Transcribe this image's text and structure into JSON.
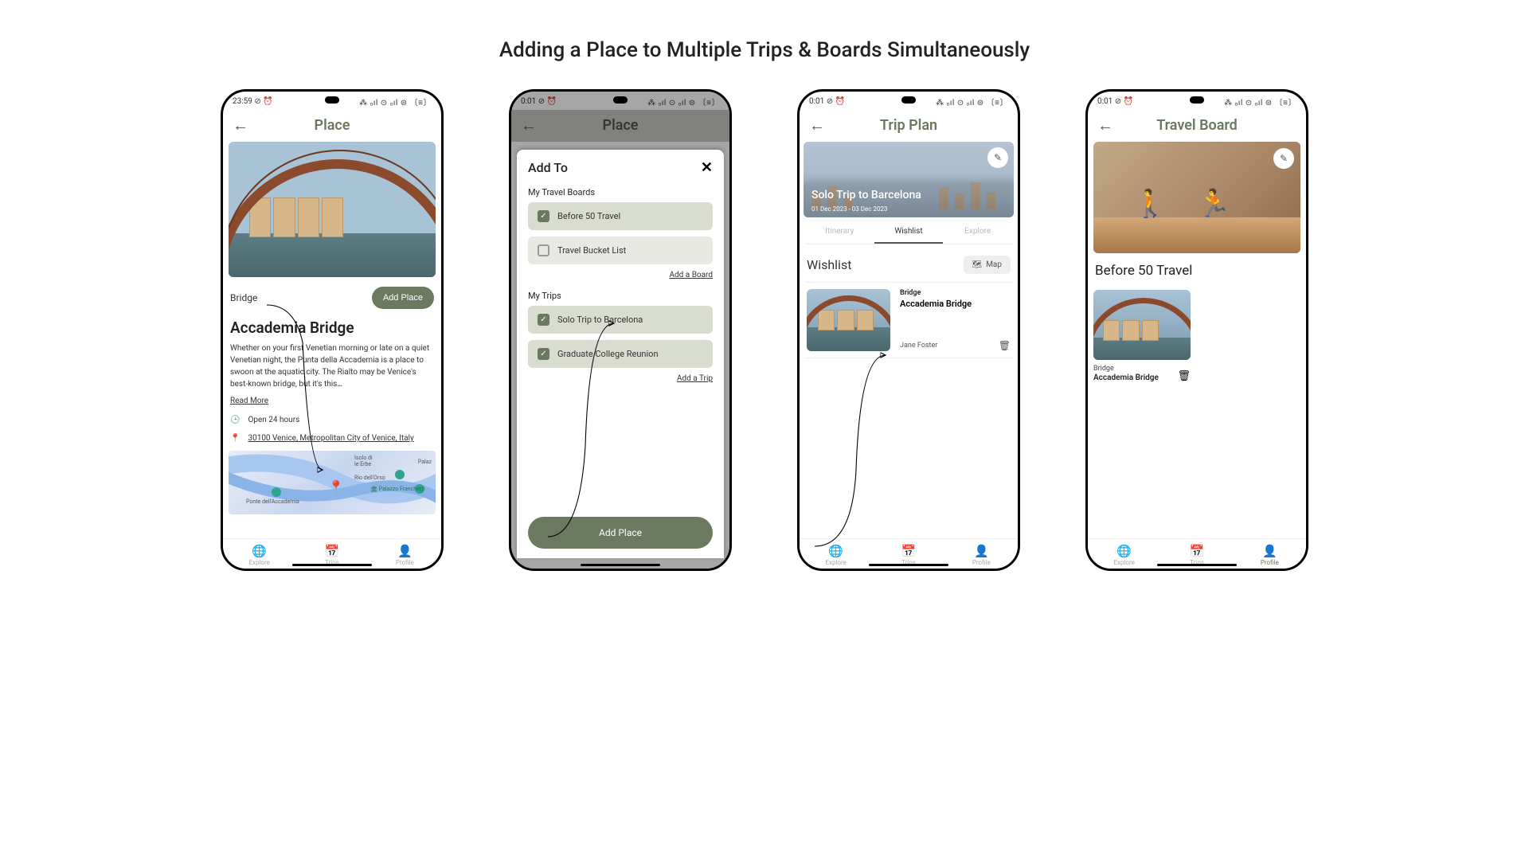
{
  "page_title": "Adding a Place to Multiple Trips & Boards Simultaneously",
  "status": {
    "t1": "23:59 ⊘ ⏰",
    "t2": "0:01 ⊘ ⏰",
    "right": "⁂ ₒıl ⊙ ₒıl ⊜ 〔≡〕"
  },
  "p1": {
    "title": "Place",
    "category": "Bridge",
    "add_place": "Add Place",
    "name": "Accademia Bridge",
    "desc": "Whether on your first Venetian morning or late on a quiet Venetian night, the Punta della Accademia is a place to swoon at the aquatic city. The Rialto may be Venice's best-known bridge, but it's this…",
    "read_more": "Read More",
    "hours": "Open 24 hours",
    "address": "30100 Venice, Metropolitan City of Venice, Italy"
  },
  "p2": {
    "title": "Place",
    "sheet_title": "Add To",
    "boards_label": "My Travel Boards",
    "boards": [
      {
        "label": "Before 50 Travel",
        "checked": true
      },
      {
        "label": "Travel Bucket List",
        "checked": false
      }
    ],
    "add_board": "Add a Board",
    "trips_label": "My Trips",
    "trips": [
      {
        "label": "Solo Trip to Barcelona",
        "checked": true
      },
      {
        "label": "Graduate College Reunion",
        "checked": true
      }
    ],
    "add_trip": "Add a Trip",
    "cta": "Add Place"
  },
  "p3": {
    "title": "Trip Plan",
    "trip_name": "Solo Trip to Barcelona",
    "dates": "01 Dec 2023 - 03 Dec 2023",
    "tabs": {
      "a": "Itinerary",
      "b": "Wishlist",
      "c": "Explore"
    },
    "section": "Wishlist",
    "map": "Map",
    "card": {
      "cat": "Bridge",
      "name": "Accademia Bridge",
      "user": "Jane Foster"
    }
  },
  "p4": {
    "title": "Travel Board",
    "board_name": "Before 50 Travel",
    "card": {
      "cat": "Bridge",
      "name": "Accademia Bridge"
    }
  },
  "nav": {
    "explore": "Explore",
    "trips": "Trips",
    "profile": "Profile"
  }
}
